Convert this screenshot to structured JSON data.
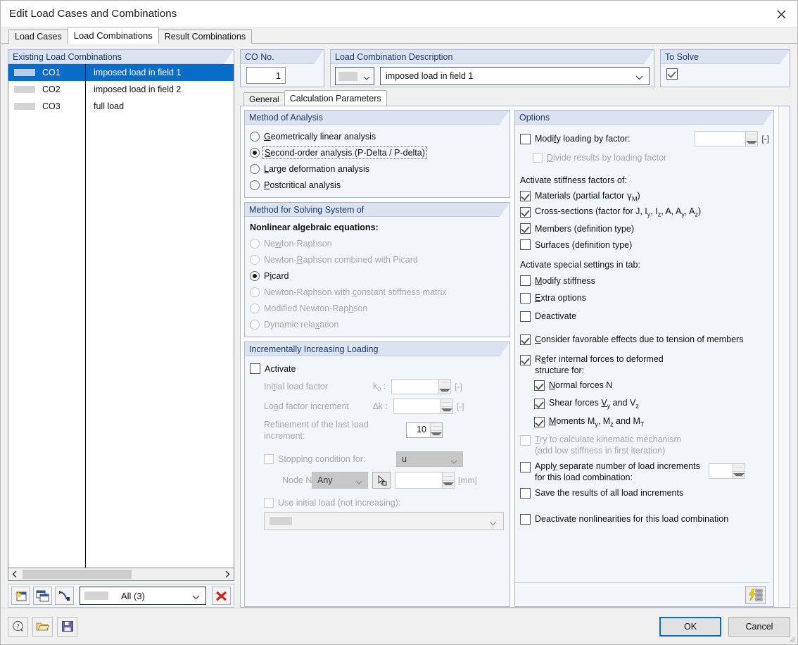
{
  "window": {
    "title": "Edit Load Cases and Combinations",
    "close_icon": "close-icon"
  },
  "tabs": [
    {
      "label": "Load Cases",
      "active": false
    },
    {
      "label": "Load Combinations",
      "active": true
    },
    {
      "label": "Result Combinations",
      "active": false
    }
  ],
  "existing": {
    "header": "Existing Load Combinations",
    "rows": [
      {
        "id": "CO1",
        "desc": "imposed load in field 1",
        "selected": true
      },
      {
        "id": "CO2",
        "desc": "imposed load in field 2",
        "selected": false
      },
      {
        "id": "CO3",
        "desc": "full load",
        "selected": false
      }
    ],
    "toolbar": {
      "new_icon": "new-combination-icon",
      "copy_icon": "copy-combination-icon",
      "renumber_icon": "renumber-icon",
      "filter_value": "All (3)",
      "filter_chevron": "chevron-down-icon",
      "delete_icon": "delete-red-x-icon"
    },
    "scroll": {
      "left_icon": "chevron-left-icon",
      "right_icon": "chevron-right-icon"
    }
  },
  "cono": {
    "header": "CO No.",
    "value": "1"
  },
  "description": {
    "header": "Load Combination Description",
    "value": "imposed load in field 1",
    "color_swatch": "color-swatch",
    "chevron": "chevron-down-icon"
  },
  "tosolve": {
    "header": "To Solve",
    "checked": true
  },
  "inner_tabs": [
    {
      "label": "General",
      "active": false
    },
    {
      "label": "Calculation Parameters",
      "active": true
    }
  ],
  "method_of_analysis": {
    "header": "Method of Analysis",
    "options": [
      {
        "label": "Geometrically linear analysis",
        "selected": false,
        "focused": false,
        "mnemonic": "G"
      },
      {
        "label": "Second-order analysis (P-Delta / P-delta)",
        "selected": true,
        "focused": true,
        "mnemonic": "S"
      },
      {
        "label": "Large deformation analysis",
        "selected": false,
        "focused": false,
        "mnemonic": "L"
      },
      {
        "label": "Postcritical analysis",
        "selected": false,
        "focused": false,
        "mnemonic": "P"
      }
    ]
  },
  "method_for_solving": {
    "header": "Method for Solving System of",
    "subtitle": "Nonlinear algebraic equations:",
    "options": [
      {
        "label": "Newton-Raphson",
        "selected": false,
        "disabled": true
      },
      {
        "label": "Newton-Raphson combined with Picard",
        "selected": false,
        "disabled": true
      },
      {
        "label": "Picard",
        "selected": true,
        "disabled": false
      },
      {
        "label": "Newton-Raphson with constant stiffness matrix",
        "selected": false,
        "disabled": true
      },
      {
        "label": "Modified Newton-Raphson",
        "selected": false,
        "disabled": true
      },
      {
        "label": "Dynamic relaxation",
        "selected": false,
        "disabled": true
      }
    ]
  },
  "incremental": {
    "header": "Incrementally Increasing Loading",
    "activate": {
      "label": "Activate",
      "checked": false
    },
    "initial_load_factor": {
      "label": "Initial load factor",
      "symbol": "k",
      "symbol_sub": "0",
      "colon": ":",
      "value": "",
      "unit": "[-]"
    },
    "load_factor_increment": {
      "label": "Load factor increment",
      "symbol": "∆k",
      "colon": ":",
      "value": "",
      "unit": "[-]"
    },
    "refinement": {
      "label_line1": "Refinement of the last load",
      "label_line2": "increment:",
      "value": "10"
    },
    "stopping_condition": {
      "label": "Stopping condition for:",
      "checked": false,
      "value": "u",
      "chevron": "chevron-down-icon"
    },
    "node_no": {
      "label": "Node No:",
      "value": "Any",
      "chevron": "chevron-down-icon",
      "pick_icon": "pick-node-icon",
      "field_value": "",
      "unit": "[mm]"
    },
    "use_initial_load": {
      "label": "Use initial load (not increasing):",
      "checked": false,
      "combo_value": "",
      "chevron": "chevron-down-icon"
    }
  },
  "options": {
    "header": "Options",
    "modify_loading": {
      "label": "Modify loading by factor:",
      "checked": false,
      "value": "",
      "unit": "[-]",
      "mnemonic": "f"
    },
    "divide_results": {
      "label": "Divide results by loading factor",
      "checked": false,
      "disabled": true,
      "mnemonic": "D"
    },
    "stiffness_title": "Activate stiffness factors of:",
    "stiffness": [
      {
        "label": "Materials (partial factor γM)",
        "checked": true
      },
      {
        "label": "Cross-sections (factor for J, Iy, Iz, A, Ay, Az)",
        "checked": true
      },
      {
        "label": "Members (definition type)",
        "checked": true
      },
      {
        "label": "Surfaces (definition type)",
        "checked": false
      }
    ],
    "special_title": "Activate special settings in tab:",
    "special": [
      {
        "label": "Modify stiffness",
        "checked": false,
        "mnemonic": "M"
      },
      {
        "label": "Extra options",
        "checked": false,
        "mnemonic": "E"
      },
      {
        "label": "Deactivate",
        "checked": false,
        "mnemonic": ""
      }
    ],
    "favorable": {
      "label": "Consider favorable effects due to tension of members",
      "checked": true,
      "mnemonic": "C"
    },
    "refer": {
      "label_line1": "Refer internal forces to deformed",
      "label_line2": "structure for:",
      "checked": true,
      "mnemonic": "R"
    },
    "refer_items": [
      {
        "label": "Normal forces N",
        "checked": true,
        "mnemonic": "N"
      },
      {
        "label": "Shear forces Vy and Vz",
        "checked": true,
        "mnemonic": "V"
      },
      {
        "label": "Moments My, Mz and MT",
        "checked": true,
        "mnemonic": "M"
      }
    ],
    "kinematic": {
      "label_line1": "Try to calculate kinematic mechanism",
      "label_line2": "(add low stiffness in first iteration)",
      "checked": false,
      "disabled": true
    },
    "apply_separate": {
      "label_line1": "Apply separate number of load increments",
      "label_line2": "for this load combination:",
      "checked": false,
      "value": ""
    },
    "save_results": {
      "label": "Save the results of all load increments",
      "checked": false
    },
    "deactivate_nonlin": {
      "label": "Deactivate nonlinearities for this load combination",
      "checked": false
    },
    "footer_icon": "calculation-settings-lightning-icon"
  },
  "footer": {
    "help_icon": "help-icon",
    "open_icon": "open-folder-icon",
    "save_icon": "save-disk-icon",
    "ok_label": "OK",
    "cancel_label": "Cancel"
  },
  "colors": {
    "selection_blue": "#0a6cc9",
    "group_header_bg": "#dbe3f0",
    "group_header_text": "#1b3a6b",
    "panel_bg": "#f2f5fa",
    "dialog_bg": "#f0f0f0"
  }
}
